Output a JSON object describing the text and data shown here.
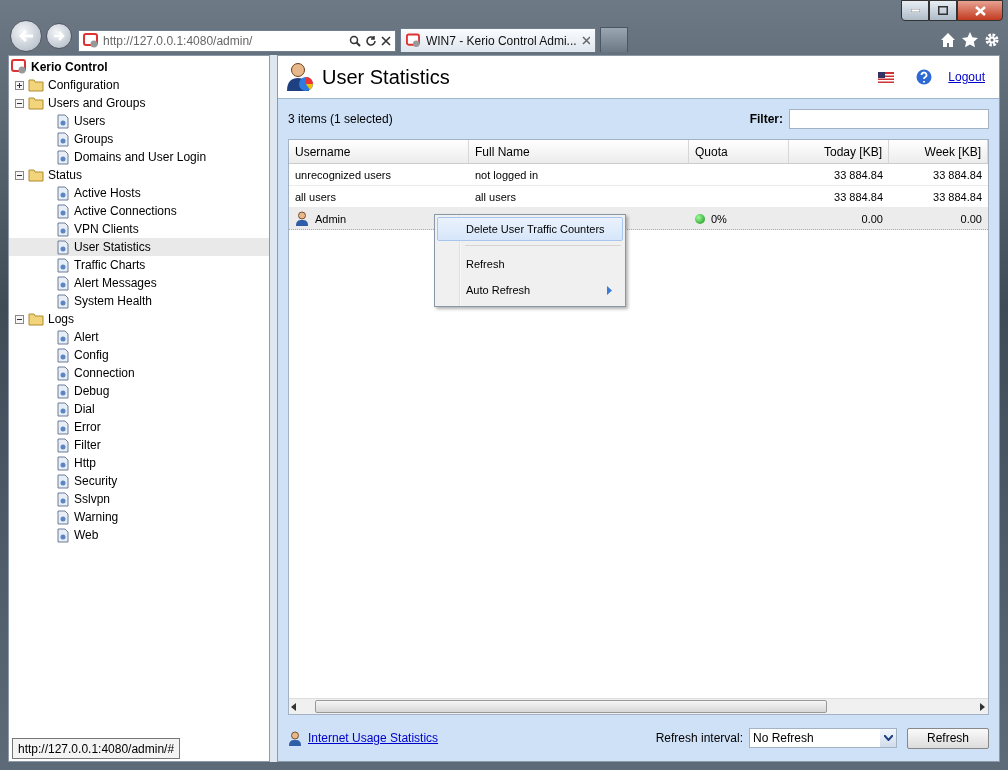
{
  "browser": {
    "address": "http://127.0.0.1:4080/admin/",
    "tab_title": "WIN7 - Kerio Control Admi...",
    "status_url": "http://127.0.0.1:4080/admin/#"
  },
  "tree": {
    "root": "Kerio Control",
    "items": [
      {
        "label": "Configuration",
        "expanded": false,
        "selected": false
      },
      {
        "label": "Users and Groups",
        "expanded": true,
        "selected": false,
        "children": [
          {
            "label": "Users",
            "selected": false
          },
          {
            "label": "Groups",
            "selected": false
          },
          {
            "label": "Domains and User Login",
            "selected": false
          }
        ]
      },
      {
        "label": "Status",
        "expanded": true,
        "selected": false,
        "children": [
          {
            "label": "Active Hosts",
            "selected": false
          },
          {
            "label": "Active Connections",
            "selected": false
          },
          {
            "label": "VPN Clients",
            "selected": false
          },
          {
            "label": "User Statistics",
            "selected": true
          },
          {
            "label": "Traffic Charts",
            "selected": false
          },
          {
            "label": "Alert Messages",
            "selected": false
          },
          {
            "label": "System Health",
            "selected": false
          }
        ]
      },
      {
        "label": "Logs",
        "expanded": true,
        "selected": false,
        "children": [
          {
            "label": "Alert",
            "selected": false
          },
          {
            "label": "Config",
            "selected": false
          },
          {
            "label": "Connection",
            "selected": false
          },
          {
            "label": "Debug",
            "selected": false
          },
          {
            "label": "Dial",
            "selected": false
          },
          {
            "label": "Error",
            "selected": false
          },
          {
            "label": "Filter",
            "selected": false
          },
          {
            "label": "Http",
            "selected": false
          },
          {
            "label": "Security",
            "selected": false
          },
          {
            "label": "Sslvpn",
            "selected": false
          },
          {
            "label": "Warning",
            "selected": false
          },
          {
            "label": "Web",
            "selected": false
          }
        ]
      }
    ]
  },
  "page": {
    "title": "User Statistics",
    "logout": "Logout",
    "count": "3 items (1 selected)",
    "filter_label": "Filter:"
  },
  "table": {
    "columns": [
      "Username",
      "Full Name",
      "Quota",
      "Today [KB]",
      "Week [KB]"
    ],
    "rows": [
      {
        "kind": "summary",
        "selected": false,
        "cells": [
          "unrecognized users",
          "not logged in",
          "",
          "33 884.84",
          "33 884.84"
        ]
      },
      {
        "kind": "summary",
        "selected": false,
        "cells": [
          "all users",
          "all users",
          "",
          "33 884.84",
          "33 884.84"
        ]
      },
      {
        "kind": "user",
        "selected": true,
        "cells": [
          "Admin",
          "",
          "0%",
          "0.00",
          "0.00"
        ]
      }
    ]
  },
  "context_menu": [
    {
      "kind": "item",
      "label": "Delete User Traffic Counters",
      "selected": true,
      "submenu": false
    },
    {
      "kind": "separator"
    },
    {
      "kind": "item",
      "label": "Refresh",
      "selected": false,
      "submenu": false
    },
    {
      "kind": "item",
      "label": "Auto Refresh",
      "selected": false,
      "submenu": true
    }
  ],
  "footer": {
    "link": "Internet Usage Statistics",
    "interval_label": "Refresh interval:",
    "interval_value": "No Refresh",
    "button": "Refresh"
  }
}
